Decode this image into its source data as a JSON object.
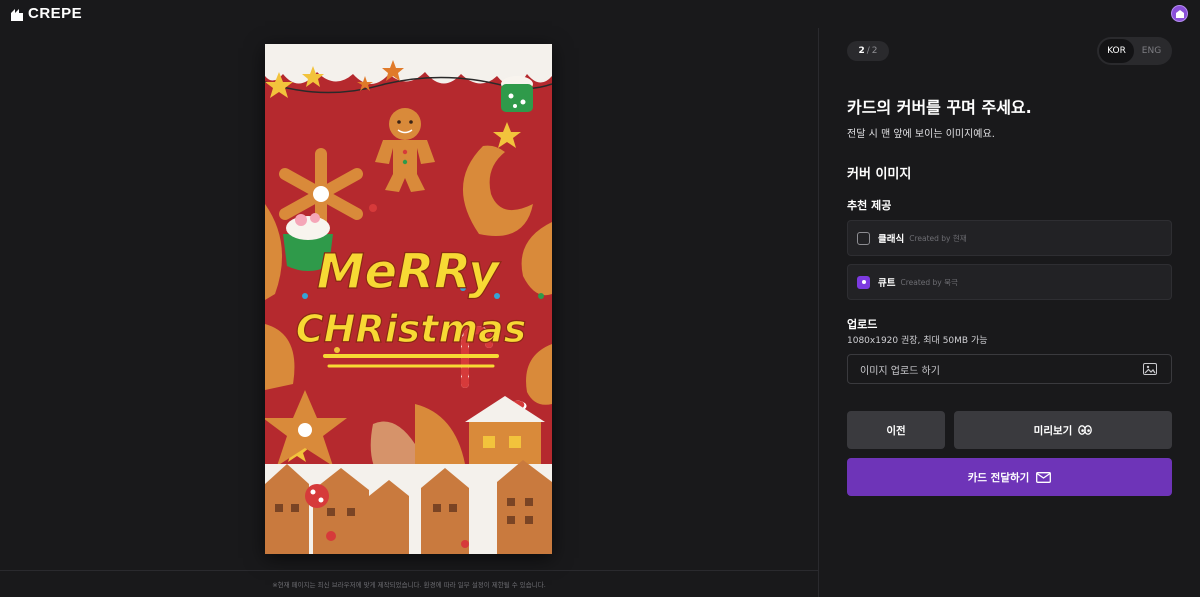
{
  "app": {
    "brand": "CREPE"
  },
  "colors": {
    "accent": "#6e34b8",
    "checkbox_accent": "#7c3ae0",
    "background": "#19191b",
    "panel": "#222225"
  },
  "card": {
    "headline_1": "MeRRy",
    "headline_2": "CHRistmas",
    "icons": [
      "gingerbread-man-icon",
      "snowflake-cookie-icon",
      "candy-cane-icon",
      "star-icon",
      "gingerbread-house-icon"
    ]
  },
  "footer": {
    "note": "※현재 페이지는 최신 브라우저에 맞게 제작되었습니다. 환경에 따라 일부 설정이 제한될 수 있습니다."
  },
  "step": {
    "current": "2",
    "separator": "/",
    "total": "2"
  },
  "language": {
    "options": [
      "KOR",
      "ENG"
    ],
    "selected": "KOR"
  },
  "main": {
    "title": "카드의 커버를 꾸며 주세요.",
    "subtitle": "전달 시 맨 앞에 보이는 이미지예요.",
    "section_title": "커버 이미지",
    "recommend_title": "추천 제공"
  },
  "options": [
    {
      "label": "클래식",
      "by": "Created by 현재",
      "checked": false
    },
    {
      "label": "큐트",
      "by": "Created by 북극",
      "checked": true
    }
  ],
  "upload": {
    "title": "업로드",
    "hint": "1080x1920 권장, 최대 50MB 가능",
    "placeholder": "이미지 업로드 하기",
    "icon": "image-upload-icon"
  },
  "buttons": {
    "prev": "이전",
    "preview": "미리보기",
    "preview_icon": "eyes-icon",
    "send": "카드 전달하기",
    "send_icon": "mail-icon"
  }
}
